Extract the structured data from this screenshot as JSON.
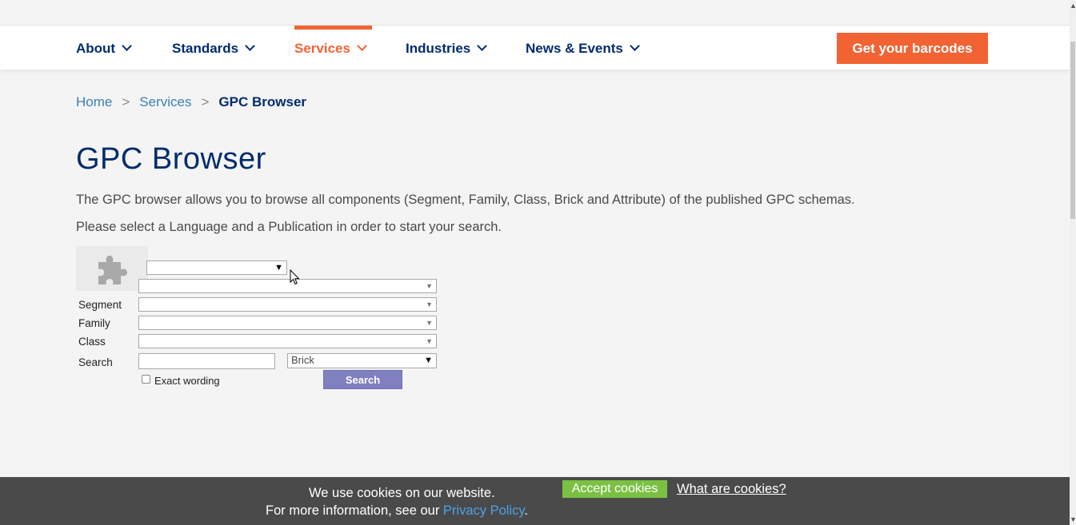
{
  "nav": {
    "items": [
      {
        "label": "About"
      },
      {
        "label": "Standards"
      },
      {
        "label": "Services",
        "active": true
      },
      {
        "label": "Industries"
      },
      {
        "label": "News & Events"
      }
    ],
    "cta_label": "Get your barcodes"
  },
  "breadcrumb": {
    "items": [
      "Home",
      "Services",
      "GPC Browser"
    ],
    "separator": ">"
  },
  "page": {
    "title": "GPC Browser",
    "intro_1": "The GPC browser allows you to browse all components (Segment, Family, Class, Brick and Attribute) of the published GPC schemas.",
    "intro_2": "Please select a Language and a Publication in order to start your search."
  },
  "form": {
    "segment_label": "Segment",
    "family_label": "Family",
    "class_label": "Class",
    "search_label": "Search",
    "search_type_value": "Brick",
    "exact_wording_label": "Exact wording",
    "search_button_label": "Search",
    "dropdown_arrow": "▼",
    "small_arrow": "▼"
  },
  "cookie": {
    "line1": "We use cookies on our website.",
    "line2_prefix": "For more information, see our ",
    "privacy_link": "Privacy Policy",
    "line2_suffix": ".",
    "accept_label": "Accept cookies",
    "what_label": "What are cookies?"
  },
  "icons": {
    "plugin": "puzzle-piece-icon",
    "cursor": "mouse-pointer-icon"
  },
  "colors": {
    "brand_navy": "#002c6c",
    "accent_orange": "#f26334",
    "link_blue": "#3b7fb6",
    "cookie_bg": "#4a4a4a",
    "accept_green": "#7ac143",
    "search_button": "#8080c0"
  }
}
